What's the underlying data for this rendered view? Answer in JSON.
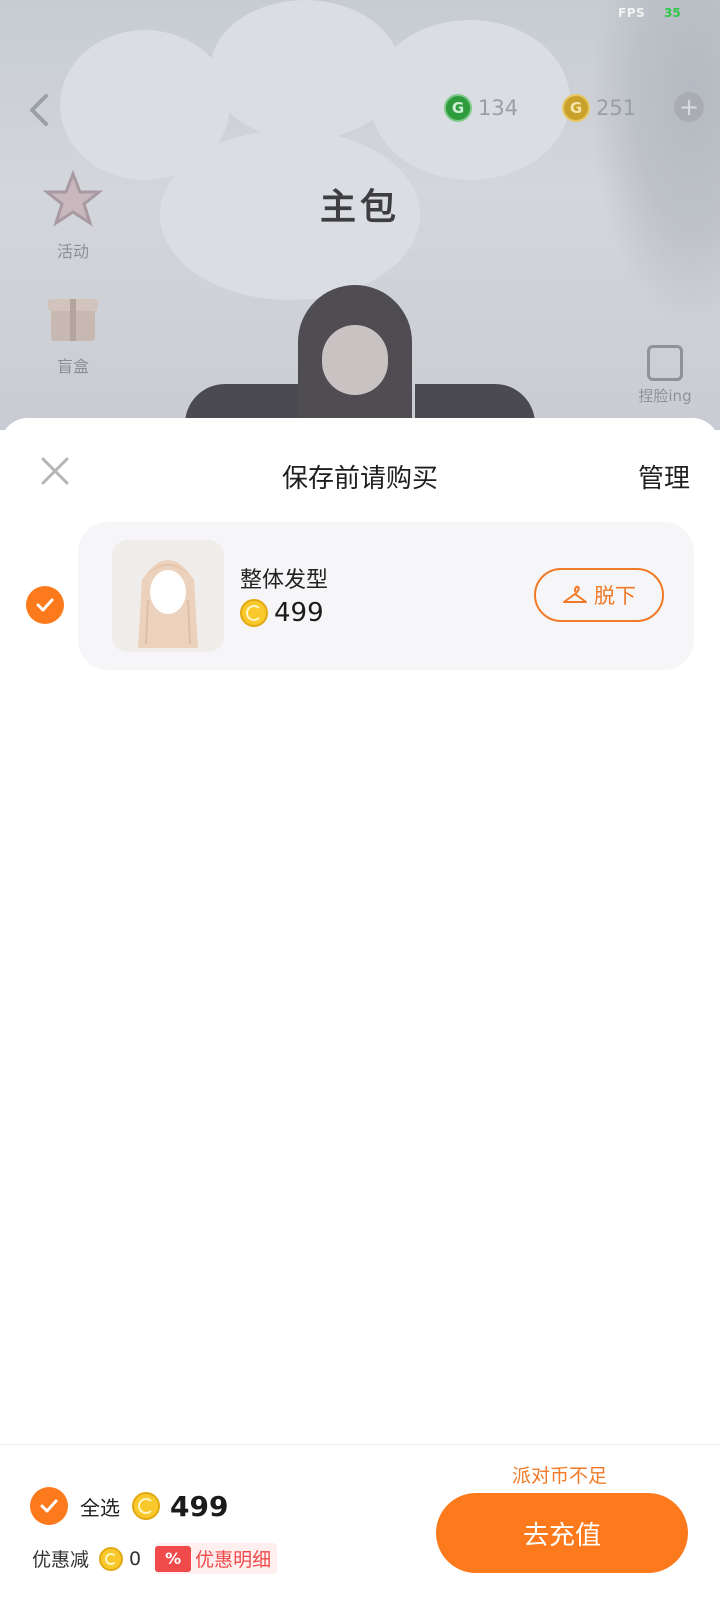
{
  "status": {
    "fps_label": "FPS",
    "fps_value": "35"
  },
  "top_bar": {
    "currency_green": {
      "amount": "134",
      "icon": "green-coin-icon",
      "color": "#2e9b3c"
    },
    "currency_gold": {
      "amount": "251",
      "icon": "gold-coin-icon",
      "color": "#e2a912"
    },
    "plus_label": "+"
  },
  "scene": {
    "title": "主包",
    "side_items": [
      {
        "label": "活动",
        "icon": "star-icon"
      },
      {
        "label": "盲盒",
        "icon": "gift-box-icon"
      }
    ],
    "face_slot_label": "捏脸ing"
  },
  "sheet": {
    "title": "保存前请购买",
    "manage_label": "管理",
    "items": [
      {
        "name": "整体发型",
        "price": "499",
        "action_label": "脱下",
        "checked": true
      }
    ]
  },
  "footer": {
    "insufficient_text": "派对币不足",
    "select_all_label": "全选",
    "total": "499",
    "discount_label": "优惠减",
    "discount_value": "0",
    "discount_tag": "%",
    "discount_detail_label": "优惠明细",
    "recharge_label": "去充值"
  },
  "colors": {
    "accent": "#fd7a1c",
    "discount_red": "#f04a4a",
    "coin_gold": "#f9c92c"
  }
}
